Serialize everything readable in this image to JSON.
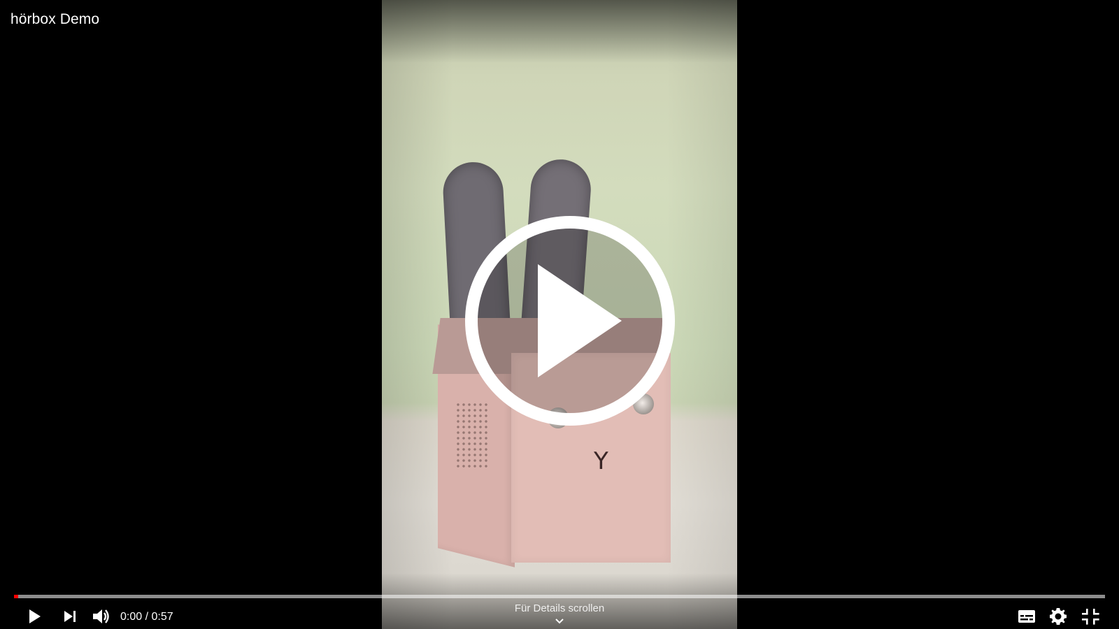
{
  "video": {
    "title": "hörbox Demo",
    "current_time": "0:00",
    "separator": " / ",
    "duration": "0:57",
    "progress_fraction": 0.0
  },
  "overlay": {
    "scroll_hint": "Für Details scrollen"
  },
  "icons": {
    "big_play": "play-circle-icon",
    "play": "play-icon",
    "next": "next-track-icon",
    "volume": "volume-icon",
    "subtitles": "subtitles-icon",
    "settings": "gear-icon",
    "exit_fullscreen": "exit-fullscreen-icon",
    "chevron": "chevron-down-icon"
  },
  "colors": {
    "progress_played": "#ff0000",
    "progress_track": "rgba(255,255,255,0.55)",
    "icon": "#ffffff"
  }
}
